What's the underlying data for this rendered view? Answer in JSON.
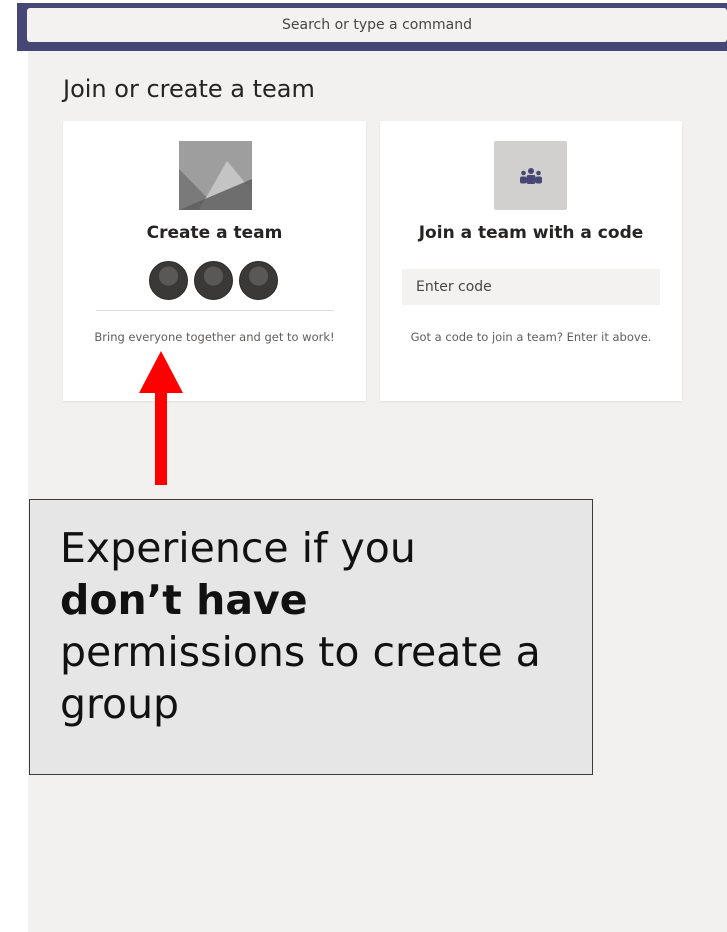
{
  "search": {
    "placeholder": "Search or type a command"
  },
  "page": {
    "title": "Join or create a team"
  },
  "create_card": {
    "title": "Create a team",
    "description": "Bring everyone together and get to work!"
  },
  "join_card": {
    "title": "Join a team with a code",
    "input_placeholder": "Enter code",
    "description": "Got a code to join a team? Enter it above."
  },
  "callout": {
    "line_start": "Experience if you",
    "bold": "don’t have",
    "line_end": "permissions to create a group"
  },
  "colors": {
    "header": "#464775",
    "content_bg": "#f3f1ef",
    "arrow": "#ff0000",
    "callout_bg": "#e6e6e6"
  }
}
